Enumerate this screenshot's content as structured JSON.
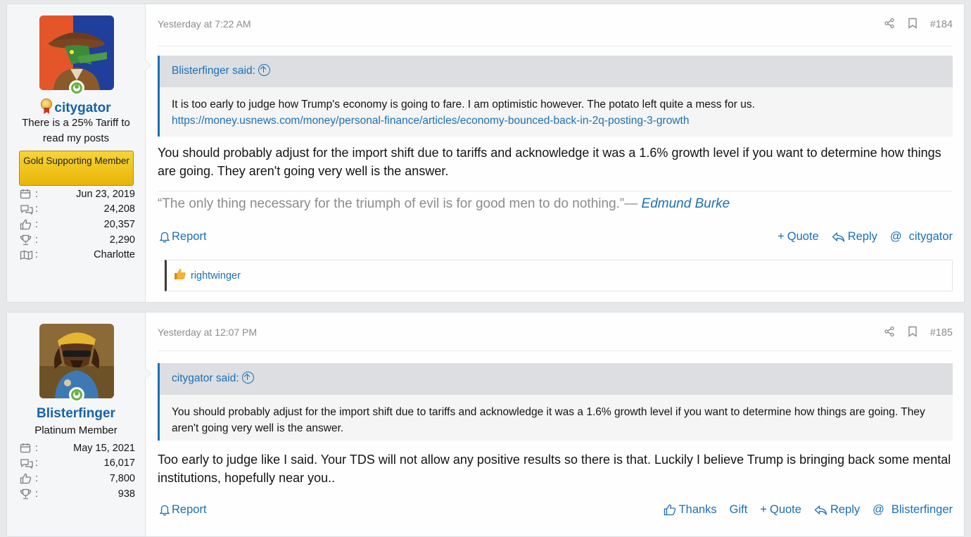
{
  "posts": [
    {
      "user": {
        "name": "citygator",
        "title": "There is a 25% Tariff to read my posts",
        "banner": "Gold Supporting Member",
        "joined": "Jun 23, 2019",
        "messages": "24,208",
        "reactions": "20,357",
        "points": "2,290",
        "location": "Charlotte"
      },
      "date": "Yesterday at 7:22 AM",
      "number": "#184",
      "quote": {
        "author": "Blisterfinger said:",
        "text": "It is too early to judge how Trump's economy is going to fare. I am optimistic however. The potato left quite a mess for us.",
        "link": "https://money.usnews.com/money/personal-finance/articles/economy-bounced-back-in-2q-posting-3-growth"
      },
      "body": "You should probably adjust for the import shift due to tariffs and acknowledge it was a 1.6% growth level if you want to determine how things are going. They aren't going very well is the answer.",
      "signature": {
        "text": "“The only thing necessary for the triumph of evil is for good men to do nothing.”— ",
        "author": "Edmund Burke"
      },
      "actions": {
        "report": "Report",
        "quote": "Quote",
        "reply": "Reply",
        "mention": "citygator"
      },
      "reaction": {
        "user": "rightwinger"
      }
    },
    {
      "user": {
        "name": "Blisterfinger",
        "title": "Platinum Member",
        "joined": "May 15, 2021",
        "messages": "16,017",
        "reactions": "7,800",
        "points": "938"
      },
      "date": "Yesterday at 12:07 PM",
      "number": "#185",
      "quote": {
        "author": "citygator said:",
        "text": "You should probably adjust for the import shift due to tariffs and acknowledge it was a 1.6% growth level if you want to determine how things are going. They aren't going very well is the answer."
      },
      "body": "Too early to judge like I said. Your TDS will not allow any positive results so there is that. Luckily I believe Trump is bringing back some mental institutions, hopefully near you..",
      "actions": {
        "report": "Report",
        "thanks": "Thanks",
        "gift": "Gift",
        "quote": "Quote",
        "reply": "Reply",
        "mention": "Blisterfinger"
      }
    }
  ],
  "colors": {
    "link": "#1d6fb5",
    "username": "#1762a8",
    "online": "#63b343",
    "gold_banner": "#f0c419"
  },
  "icons": [
    "calendar-icon",
    "messages-icon",
    "thumbs-up-icon",
    "trophy-icon",
    "map-icon",
    "share-icon",
    "bookmark-icon",
    "bell-icon",
    "reply-icon",
    "at-icon",
    "plus-icon"
  ]
}
